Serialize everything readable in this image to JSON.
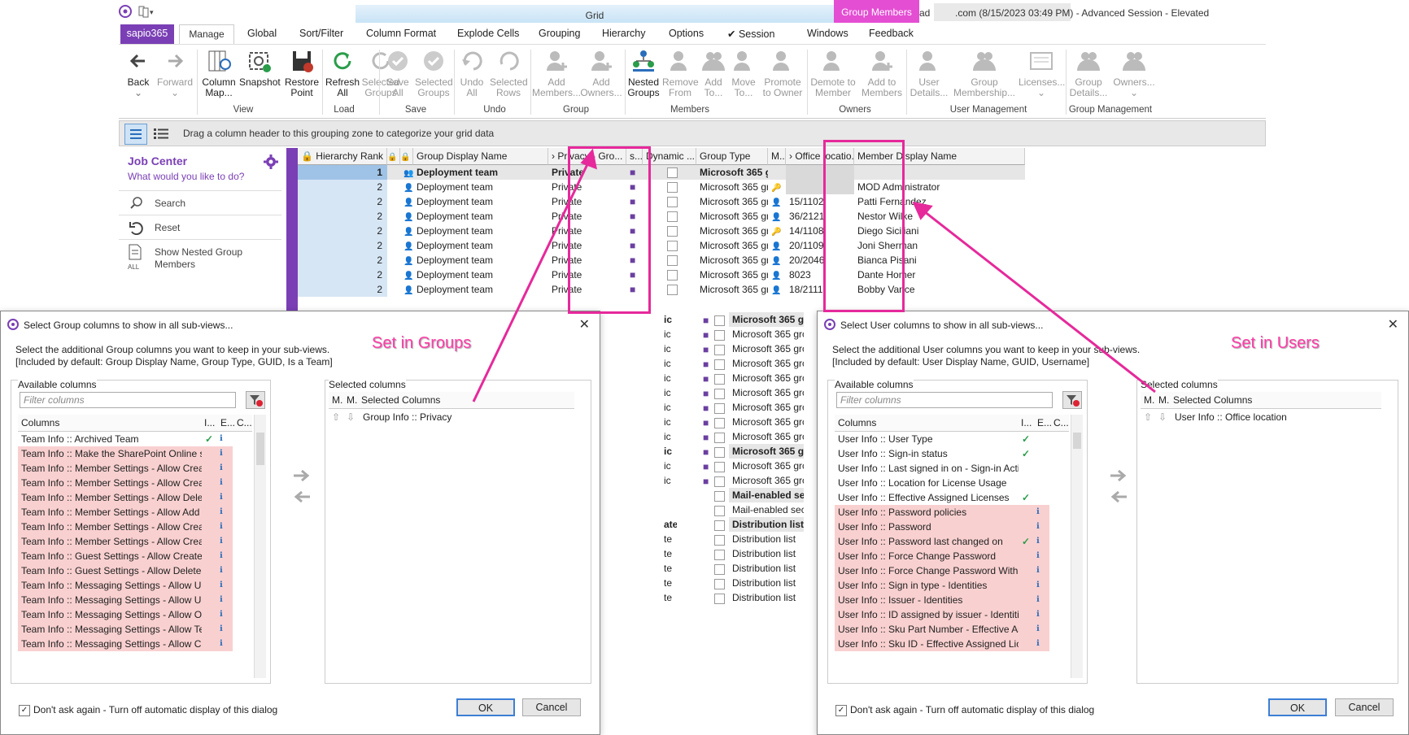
{
  "window": {
    "grid_tab": "Grid",
    "context_tab": "Group Members",
    "title_prefix": "ad",
    "title_suffix": ".com (8/15/2023 03:49 PM) - Advanced Session - Elevated"
  },
  "menu": {
    "brand": "sapio365",
    "items": [
      "Manage",
      "Global",
      "Sort/Filter",
      "Column Format",
      "Explode Cells",
      "Grouping",
      "Hierarchy",
      "Options",
      "✔ Session",
      "Windows",
      "Feedback"
    ]
  },
  "ribbon": {
    "buttons": [
      {
        "label": "Back",
        "label2": "",
        "icon": "arrow-left-icon",
        "disabled": false
      },
      {
        "label": "Forward",
        "label2": "",
        "icon": "arrow-right-icon",
        "disabled": true
      },
      {
        "label": "Column",
        "label2": "Map...",
        "icon": "column-map-icon",
        "disabled": false
      },
      {
        "label": "Snapshot",
        "label2": "",
        "icon": "snapshot-icon",
        "disabled": false
      },
      {
        "label": "Restore",
        "label2": "Point",
        "icon": "restore-point-icon",
        "disabled": false
      },
      {
        "label": "Refresh",
        "label2": "All",
        "icon": "refresh-icon",
        "disabled": false
      },
      {
        "label": "Refresh",
        "label2": "Selected Groups",
        "icon": "refresh-selected-icon",
        "disabled": true
      },
      {
        "label": "Save",
        "label2": "All",
        "icon": "save-all-icon",
        "disabled": true
      },
      {
        "label": "Selected",
        "label2": "Groups",
        "icon": "save-selected-icon",
        "disabled": true
      },
      {
        "label": "Undo",
        "label2": "All",
        "icon": "undo-icon",
        "disabled": true
      },
      {
        "label": "Selected",
        "label2": "Rows",
        "icon": "undo-selected-icon",
        "disabled": true
      },
      {
        "label": "Add",
        "label2": "Members...",
        "icon": "add-members-icon",
        "disabled": true
      },
      {
        "label": "Add",
        "label2": "Owners...",
        "icon": "add-owners-icon",
        "disabled": true
      },
      {
        "label": "Nested",
        "label2": "Groups",
        "icon": "nested-groups-icon",
        "disabled": false
      },
      {
        "label": "Remove",
        "label2": "From",
        "icon": "remove-from-icon",
        "disabled": true
      },
      {
        "label": "Add",
        "label2": "To...",
        "icon": "add-to-icon",
        "disabled": true
      },
      {
        "label": "Move",
        "label2": "To...",
        "icon": "move-to-icon",
        "disabled": true
      },
      {
        "label": "Promote",
        "label2": "to Owner",
        "icon": "promote-icon",
        "disabled": true
      },
      {
        "label": "Demote to",
        "label2": "Member",
        "icon": "demote-icon",
        "disabled": true
      },
      {
        "label": "Add to",
        "label2": "Members",
        "icon": "add-to-members-icon",
        "disabled": true
      },
      {
        "label": "User",
        "label2": "Details...",
        "icon": "user-details-icon",
        "disabled": true
      },
      {
        "label": "Group",
        "label2": "Membership...",
        "icon": "group-membership-icon",
        "disabled": true
      },
      {
        "label": "Licenses...",
        "label2": "",
        "icon": "licenses-icon",
        "disabled": true
      },
      {
        "label": "Group",
        "label2": "Details...",
        "icon": "group-details-icon",
        "disabled": true
      },
      {
        "label": "Owners...",
        "label2": "",
        "icon": "owners-icon",
        "disabled": true
      }
    ],
    "groups": [
      "View",
      "Load",
      "Save",
      "Undo",
      "Group",
      "Members",
      "Owners",
      "User Management",
      "Group Management"
    ]
  },
  "grouping_zone": {
    "text": "Drag a column header to this grouping zone to categorize your grid data"
  },
  "job_center": {
    "title": "Job Center",
    "subtitle": "What would you like to do?",
    "items": [
      {
        "label": "Search"
      },
      {
        "label": "Reset"
      },
      {
        "label": "Show Nested Group Members",
        "sublabel": "ALL"
      }
    ]
  },
  "grid": {
    "headers": {
      "rank": "Hierarchy Rank",
      "group_name": "Group Display Name",
      "privacy": "Privacy - Gro...",
      "s": "s...",
      "dynamic": "Dynamic ...",
      "group_type": "Group Type",
      "m": "M...",
      "office": "Office locatio...",
      "member": "Member Display Name"
    },
    "rows": [
      {
        "rank": "1",
        "name": "Deployment team",
        "privacy": "Private",
        "type": "Microsoft 365 gr",
        "office": "",
        "member": "",
        "bold": true
      },
      {
        "rank": "2",
        "name": "Deployment team",
        "privacy": "Private",
        "type": "Microsoft 365 grc",
        "office": "",
        "member": "MOD Administrator"
      },
      {
        "rank": "2",
        "name": "Deployment team",
        "privacy": "Private",
        "type": "Microsoft 365 grc",
        "office": "15/1102",
        "member": "Patti Fernandez"
      },
      {
        "rank": "2",
        "name": "Deployment team",
        "privacy": "Private",
        "type": "Microsoft 365 grc",
        "office": "36/2121",
        "member": "Nestor Wilke"
      },
      {
        "rank": "2",
        "name": "Deployment team",
        "privacy": "Private",
        "type": "Microsoft 365 grc",
        "office": "14/1108",
        "member": "Diego Siciliani"
      },
      {
        "rank": "2",
        "name": "Deployment team",
        "privacy": "Private",
        "type": "Microsoft 365 grc",
        "office": "20/1109",
        "member": "Joni Sherman"
      },
      {
        "rank": "2",
        "name": "Deployment team",
        "privacy": "Private",
        "type": "Microsoft 365 grc",
        "office": "20/2046",
        "member": "Bianca Pisani"
      },
      {
        "rank": "2",
        "name": "Deployment team",
        "privacy": "Private",
        "type": "Microsoft 365 grc",
        "office": "8023",
        "member": "Dante Homer"
      },
      {
        "rank": "2",
        "name": "Deployment team",
        "privacy": "Private",
        "type": "Microsoft 365 grc",
        "office": "18/2111",
        "member": "Bobby Vance"
      }
    ],
    "behind_rows": [
      {
        "privacy": "ic",
        "type": "Microsoft 365 gı",
        "bold": true
      },
      {
        "privacy": "ic",
        "type": "Microsoft 365 grc"
      },
      {
        "privacy": "ic",
        "type": "Microsoft 365 grc"
      },
      {
        "privacy": "ic",
        "type": "Microsoft 365 grc"
      },
      {
        "privacy": "ic",
        "type": "Microsoft 365 grc"
      },
      {
        "privacy": "ic",
        "type": "Microsoft 365 grc"
      },
      {
        "privacy": "ic",
        "type": "Microsoft 365 grc"
      },
      {
        "privacy": "ic",
        "type": "Microsoft 365 grc"
      },
      {
        "privacy": "ic",
        "type": "Microsoft 365 grc"
      },
      {
        "privacy": "ic",
        "type": "Microsoft 365 gı",
        "bold": true
      },
      {
        "privacy": "ic",
        "type": "Microsoft 365 grc"
      },
      {
        "privacy": "ic",
        "type": "Microsoft 365 grc"
      },
      {
        "privacy": "",
        "type": "Mail-enabled sec",
        "bold": true
      },
      {
        "privacy": "",
        "type": "Mail-enabled sec"
      },
      {
        "privacy": "ate",
        "type": "Distribution list",
        "bold": true
      },
      {
        "privacy": "te",
        "type": "Distribution list"
      },
      {
        "privacy": "te",
        "type": "Distribution list"
      },
      {
        "privacy": "te",
        "type": "Distribution list"
      },
      {
        "privacy": "te",
        "type": "Distribution list"
      },
      {
        "privacy": "te",
        "type": "Distribution list"
      }
    ]
  },
  "dialog_groups": {
    "title": "Select Group columns to show in all sub-views...",
    "desc1": "Select the additional Group columns you want to keep in your sub-views.",
    "desc2": "[Included by default: Group Display Name, Group Type, GUID, Is a Team]",
    "available_label": "Available columns",
    "filter_placeholder": "Filter columns",
    "col_header": "Columns",
    "col_h2": "I...",
    "col_h3": "E...",
    "col_h4": "C...",
    "selected_label": "Selected columns",
    "sel_h1": "M.",
    "sel_h2": "M.",
    "sel_h3": "Selected Columns",
    "selected": [
      "Group Info :: Privacy"
    ],
    "available": [
      {
        "text": "Team Info :: Archived Team",
        "pink": false,
        "check": true
      },
      {
        "text": "Team Info :: Make the SharePoint Online s",
        "pink": true,
        "check": false
      },
      {
        "text": "Team Info :: Member Settings - Allow Crea",
        "pink": true,
        "check": false
      },
      {
        "text": "Team Info :: Member Settings - Allow Crea",
        "pink": true,
        "check": false
      },
      {
        "text": "Team Info :: Member Settings - Allow Dele",
        "pink": true,
        "check": false
      },
      {
        "text": "Team Info :: Member Settings - Allow Add",
        "pink": true,
        "check": false
      },
      {
        "text": "Team Info :: Member Settings - Allow Crea",
        "pink": true,
        "check": false
      },
      {
        "text": "Team Info :: Member Settings - Allow Crea",
        "pink": true,
        "check": false
      },
      {
        "text": "Team Info :: Guest Settings - Allow Create",
        "pink": true,
        "check": false
      },
      {
        "text": "Team Info :: Guest Settings - Allow Delete",
        "pink": true,
        "check": false
      },
      {
        "text": "Team Info :: Messaging Settings - Allow U:",
        "pink": true,
        "check": false
      },
      {
        "text": "Team Info :: Messaging Settings - Allow U:",
        "pink": true,
        "check": false
      },
      {
        "text": "Team Info :: Messaging Settings - Allow O",
        "pink": true,
        "check": false
      },
      {
        "text": "Team Info :: Messaging Settings - Allow Te",
        "pink": true,
        "check": false
      },
      {
        "text": "Team Info :: Messaging Settings - Allow Cl",
        "pink": true,
        "check": false
      }
    ],
    "dont_ask": "Don't ask again - Turn off automatic display of this dialog",
    "ok": "OK",
    "cancel": "Cancel",
    "annotation": "Set in Groups"
  },
  "dialog_users": {
    "title": "Select User columns to show in all sub-views...",
    "desc1": "Select the additional User columns you want to keep in your sub-views.",
    "desc2": "[Included by default: User Display Name, GUID, Username]",
    "available_label": "Available columns",
    "filter_placeholder": "Filter columns",
    "col_header": "Columns",
    "col_h2": "I...",
    "col_h3": "E...",
    "col_h4": "C...",
    "selected_label": "Selected columns",
    "sel_h1": "M.",
    "sel_h2": "M.",
    "sel_h3": "Selected Columns",
    "selected": [
      "User Info :: Office location"
    ],
    "available": [
      {
        "text": "User Info :: User Type",
        "pink": false,
        "check": true
      },
      {
        "text": "User Info :: Sign-in status",
        "pink": false,
        "check": true
      },
      {
        "text": "User Info :: Last signed in on - Sign-in Acti",
        "pink": false,
        "check": false
      },
      {
        "text": "User Info :: Location for License Usage",
        "pink": false,
        "check": false
      },
      {
        "text": "User Info :: Effective Assigned Licenses",
        "pink": false,
        "check": true
      },
      {
        "text": "User Info :: Password policies",
        "pink": true,
        "check": false
      },
      {
        "text": "User Info :: Password",
        "pink": true,
        "check": false
      },
      {
        "text": "User Info :: Password last changed on",
        "pink": true,
        "check": true
      },
      {
        "text": "User Info :: Force Change Password",
        "pink": true,
        "check": false
      },
      {
        "text": "User Info :: Force Change Password With M",
        "pink": true,
        "check": false
      },
      {
        "text": "User Info :: Sign in type - Identities",
        "pink": true,
        "check": false
      },
      {
        "text": "User Info :: Issuer - Identities",
        "pink": true,
        "check": false
      },
      {
        "text": "User Info :: ID assigned by issuer - Identiti",
        "pink": true,
        "check": false
      },
      {
        "text": "User Info :: Sku Part Number - Effective As",
        "pink": true,
        "check": false
      },
      {
        "text": "User Info :: Sku ID - Effective Assigned Lice",
        "pink": true,
        "check": false
      }
    ],
    "dont_ask": "Don't ask again - Turn off automatic display of this dialog",
    "ok": "OK",
    "cancel": "Cancel",
    "annotation": "Set in Users"
  },
  "colors": {
    "accent": "#7a3fb5",
    "magenta": "#e6299b",
    "pink_row": "#f9d0d0",
    "rank_bg": "#d6e6f5"
  }
}
